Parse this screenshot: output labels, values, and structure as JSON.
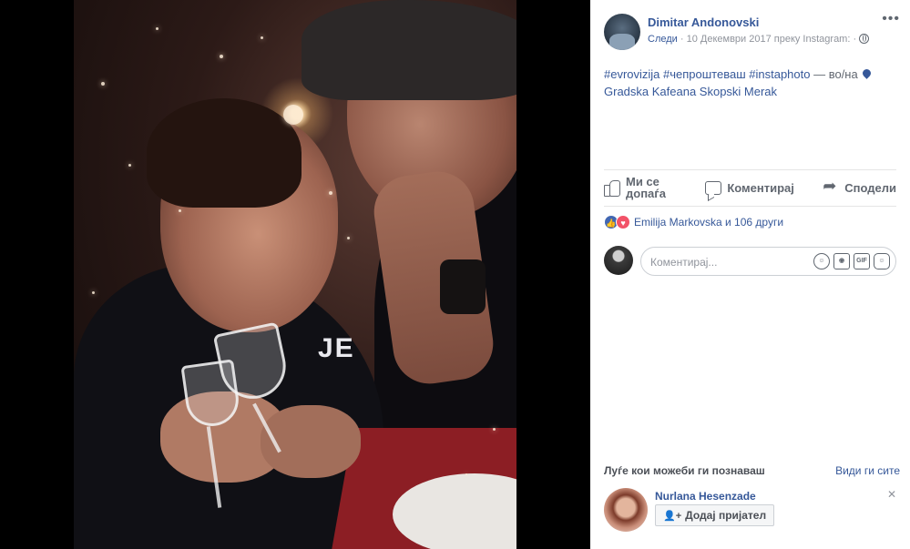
{
  "post": {
    "author": "Dimitar Andonovski",
    "follow": "Следи",
    "meta": " · 10 Декември 2017 преку Instagram: · ",
    "more": "•••",
    "text": {
      "hashtags": "#evrovizija #чепроштеваш #instaphoto",
      "dash": " — во/на ",
      "place": "Gradska Kafeana Skopski Merak"
    },
    "photo_shirt_text": "JE"
  },
  "actions": {
    "like": "Ми се допаѓа",
    "comment": "Коментирај",
    "share": "Сподели"
  },
  "reactions": {
    "summary": "Emilija Markovska и 106 други"
  },
  "comment_box": {
    "placeholder": "Коментирај..."
  },
  "pymk": {
    "title": "Луѓе кои можеби ги познаваш",
    "see_all": "Види ги сите",
    "people": [
      {
        "name": "Nurlana Hesenzade",
        "add_label": "Додај пријател"
      }
    ]
  },
  "colors": {
    "link": "#365899",
    "muted": "#90949c",
    "like_blue": "#4267b2",
    "love_red": "#f25268"
  }
}
